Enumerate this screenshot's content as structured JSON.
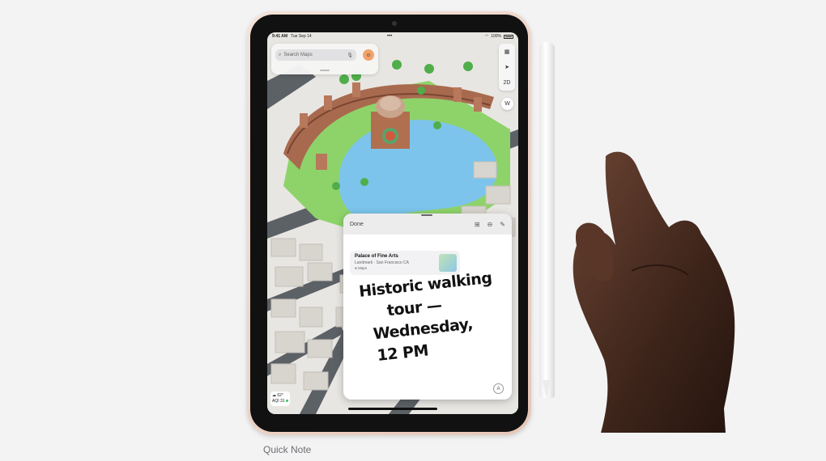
{
  "caption": "Quick Note",
  "status_bar": {
    "time": "9:41 AM",
    "date": "Tue Sep 14",
    "battery": "100%"
  },
  "search": {
    "placeholder": "Search Maps"
  },
  "map_controls": {
    "view_mode": "2D",
    "compass": "W"
  },
  "weather": {
    "temp": "62°",
    "aqi": "AQI 31"
  },
  "quick_note": {
    "done_label": "Done",
    "link": {
      "title": "Palace of Fine Arts",
      "subtitle": "Landmark · San Francisco CA",
      "source": "Maps"
    },
    "handwriting": [
      "Historic walking",
      "tour —",
      "Wednesday,",
      "12 PM"
    ]
  },
  "icons": [
    "search-icon",
    "mic-icon",
    "avatar",
    "map-icon",
    "location-arrow-icon",
    "grid-icon",
    "ellipsis-icon",
    "compose-icon",
    "markup-icon",
    "cloud-icon"
  ],
  "colors": {
    "water": "#7cc4ec",
    "park": "#8ed36a",
    "building": "#a86a4f",
    "road": "#5c6166"
  }
}
